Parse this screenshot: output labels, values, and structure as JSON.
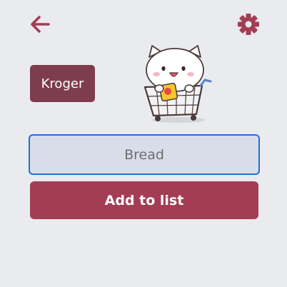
{
  "header": {
    "back_icon": "arrow-left-icon",
    "settings_icon": "gear-icon",
    "accent_color": "#a23d54"
  },
  "store": {
    "name": "Kroger",
    "color": "#7e3d4e"
  },
  "mascot": {
    "icon": "cat-shopping-cart-illustration"
  },
  "item_input": {
    "value": "Bread",
    "placeholder": ""
  },
  "add_button": {
    "label": "Add to list",
    "color": "#a23d54"
  }
}
